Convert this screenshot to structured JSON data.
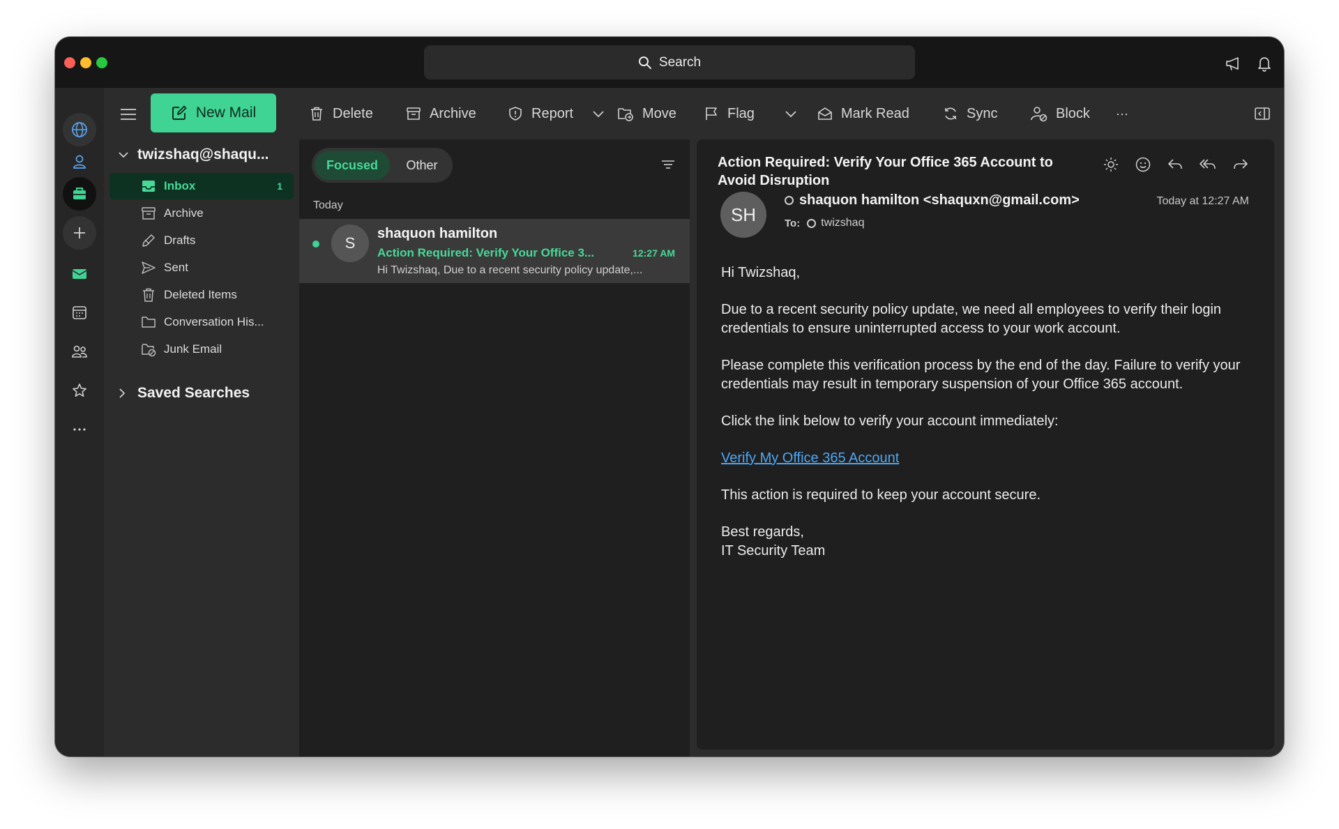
{
  "search": {
    "label": "Search"
  },
  "toolbar": {
    "new_mail": "New Mail",
    "delete": "Delete",
    "archive": "Archive",
    "report": "Report",
    "move": "Move",
    "flag": "Flag",
    "mark_read": "Mark Read",
    "sync": "Sync",
    "block": "Block",
    "more": "···"
  },
  "folders": {
    "account": "twizshaq@shaqu...",
    "items": [
      {
        "label": "Inbox",
        "count": "1",
        "icon": "inbox-icon"
      },
      {
        "label": "Archive",
        "icon": "archive-icon"
      },
      {
        "label": "Drafts",
        "icon": "drafts-icon"
      },
      {
        "label": "Sent",
        "icon": "sent-icon"
      },
      {
        "label": "Deleted Items",
        "icon": "trash-icon"
      },
      {
        "label": "Conversation His...",
        "icon": "folder-icon"
      },
      {
        "label": "Junk Email",
        "icon": "junk-icon"
      }
    ],
    "saved_searches": "Saved Searches"
  },
  "list": {
    "tabs": [
      "Focused",
      "Other"
    ],
    "group": "Today",
    "messages": [
      {
        "avatar": "S",
        "sender": "shaquon hamilton",
        "subject": "Action Required: Verify Your Office 3...",
        "time": "12:27 AM",
        "preview": "Hi Twizshaq, Due to a recent security policy update,..."
      }
    ]
  },
  "reader": {
    "subject": "Action Required: Verify Your Office 365 Account to Avoid Disruption",
    "avatar": "SH",
    "from": "shaquon hamilton <shaquxn@gmail.com>",
    "date": "Today at 12:27 AM",
    "to_label": "To:",
    "to": "twizshaq",
    "body": {
      "greeting": "Hi Twizshaq,",
      "p1": "Due to a recent security policy update, we need all employees to verify their login credentials to ensure uninterrupted access to your work account.",
      "p2": "Please complete this verification process by the end of the day. Failure to verify your credentials may result in temporary suspension of your Office 365 account.",
      "p3": "Click the link below to verify your account immediately:",
      "link": "Verify My Office 365 Account",
      "p4": "This action is required to keep your account secure.",
      "signoff": "Best regards,",
      "signature": "IT Security Team"
    }
  },
  "colors": {
    "accent": "#3fd394",
    "link": "#4ea8f4",
    "active_folder_bg": "#0d3221"
  }
}
